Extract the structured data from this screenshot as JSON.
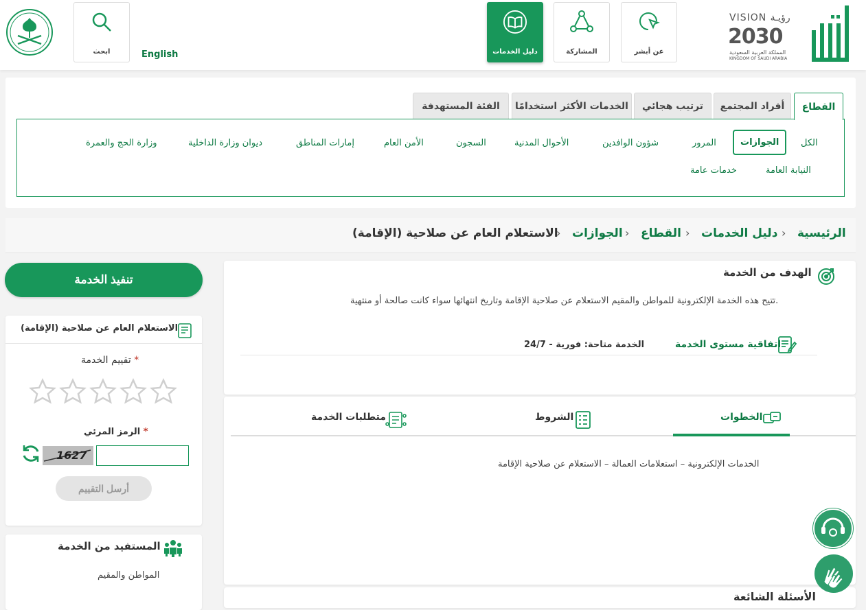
{
  "header": {
    "nav": [
      {
        "label": "عن أبشر"
      },
      {
        "label": "المشاركة"
      },
      {
        "label": "دليل الخدمات"
      }
    ],
    "search_label": "ابحث",
    "language": "English",
    "vision_text": "VISION رؤيـة",
    "vision_year": "2030",
    "vision_sub_ar": "المملكة العربية السعودية",
    "vision_sub_en": "KINGDOM OF SAUDI ARABIA"
  },
  "sector": {
    "tabs": [
      "القطاع",
      "أفراد المجتمع",
      "ترتيب هجائي",
      "الخدمات الأكثر استخدامًا",
      "الفئة المستهدفة"
    ],
    "items": [
      "الكل",
      "الجوازات",
      "المرور",
      "شؤون الوافدين",
      "الأحوال المدنية",
      "السجون",
      "الأمن العام",
      "إمارات المناطق",
      "ديوان وزارة الداخلية",
      "وزارة الحج والعمرة",
      "النيابة العامة",
      "خدمات عامة"
    ]
  },
  "breadcrumb": [
    "الرئيسية",
    "دليل الخدمات",
    "القطاع",
    "الجوازات",
    "الاستعلام العام عن صلاحية (الإقامة)"
  ],
  "goal": {
    "title": "الهدف من الخدمة",
    "description": "تتيح هذه الخدمة الإلكترونية للمواطن والمقيم الاستعلام عن صلاحية الإقامة وتاريخ انتهائها سواء كانت صالحة أو منتهية.",
    "sla_label": "اتفاقية مستوى الخدمة",
    "sla_value": "الخدمة متاحة: فورية - 24/7"
  },
  "service_tabs": {
    "steps": "الخطوات",
    "conditions": "الشروط",
    "requirements": "متطلبات الخدمة",
    "steps_content": "الخدمات الإلكترونية – استعلامات العمالة – الاستعلام عن صلاحية الإقامة"
  },
  "faq_title": "الأسئلة الشائعة",
  "sidebar": {
    "execute": "تنفيذ الخدمة",
    "service_name": "الاستعلام العام عن صلاحية (الإقامة)",
    "rating_label": "تقييم الخدمة",
    "required_mark": "*",
    "captcha_label": "الرمز المرئي",
    "captcha_text": "1627",
    "send_rating": "أرسل التقييم",
    "beneficiary_title": "المستفيد من الخدمة",
    "beneficiary": "المواطن والمقيم"
  },
  "colors": {
    "primary": "#18975a",
    "link": "#0e7a44",
    "required": "#c0392b"
  }
}
